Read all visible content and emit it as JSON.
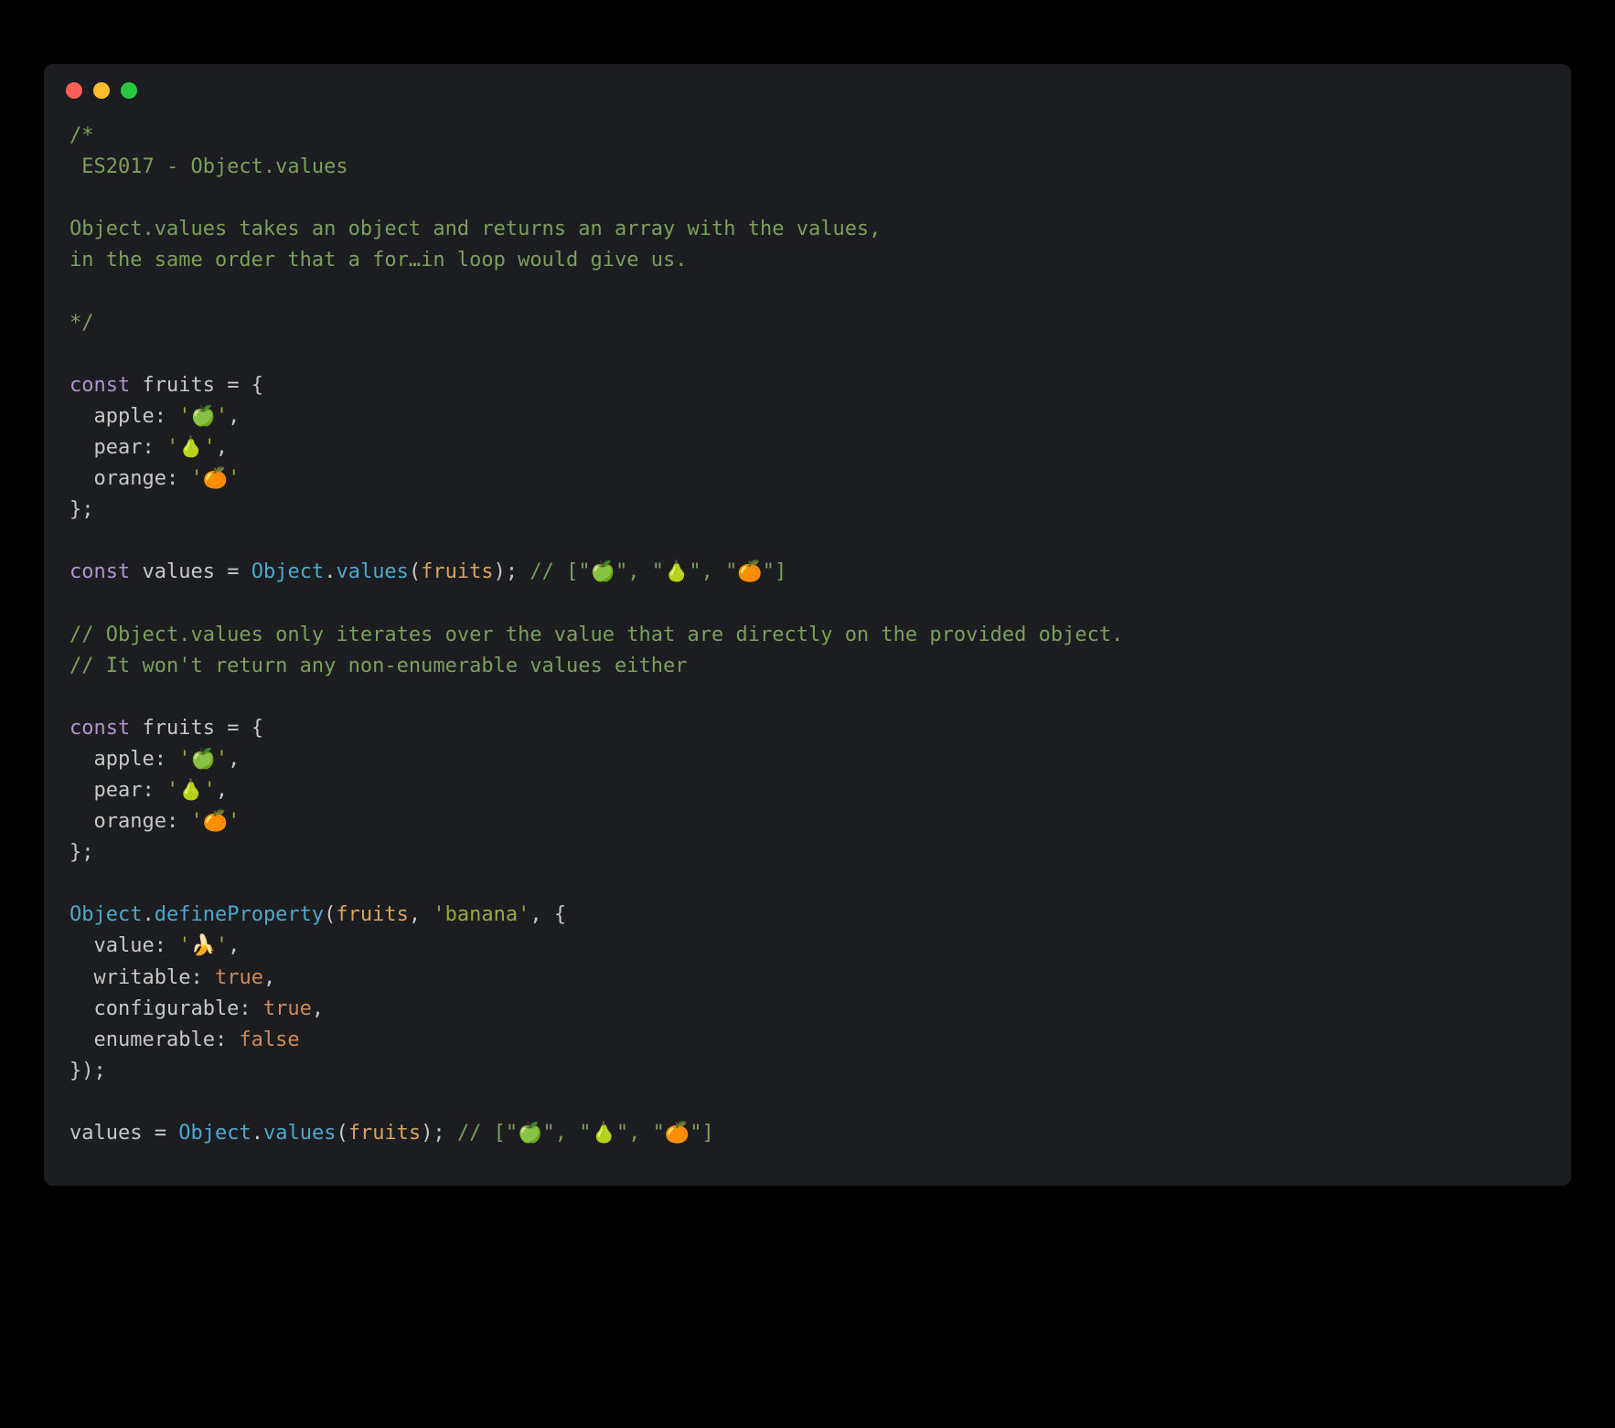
{
  "code": {
    "block_comment": "/*\n ES2017 - Object.values\n\nObject.values takes an object and returns an array with the values,\nin the same order that a for…in loop would give us.\n\n*/",
    "kw_const": "const",
    "id_fruits": "fruits",
    "eq_brace_open": " = {",
    "prop_apple_key": "  apple: ",
    "prop_apple_val": "'🍏'",
    "comma": ",",
    "prop_pear_key": "  pear: ",
    "prop_pear_val": "'🍐'",
    "prop_orange_key": "  orange: ",
    "prop_orange_val": "'🍊'",
    "brace_close_semi": "};",
    "id_values": "values",
    "eq_sp": " = ",
    "class_object": "Object",
    "dot": ".",
    "m_values": "values",
    "lparen": "(",
    "rparen_semi": "); ",
    "inline_result": "// [\"🍏\", \"🍐\", \"🍊\"]",
    "line_comment_1": "// Object.values only iterates over the value that are directly on the provided object.",
    "line_comment_2": "// It won't return any non-enumerable values either",
    "m_defineProperty": "defineProperty",
    "param_fruits": "fruits",
    "comma_sp": ", ",
    "str_banana": "'banana'",
    "comma_sp_brace": ", {",
    "prop_value_key": "  value: ",
    "prop_value_val": "'🍌'",
    "prop_writable_key": "  writable: ",
    "bool_true": "true",
    "prop_configurable_key": "  configurable: ",
    "prop_enumerable_key": "  enumerable: ",
    "bool_false": "false",
    "brace_rparen_semi": "});",
    "id_values2": "values",
    "rparen_semi2": "); "
  }
}
